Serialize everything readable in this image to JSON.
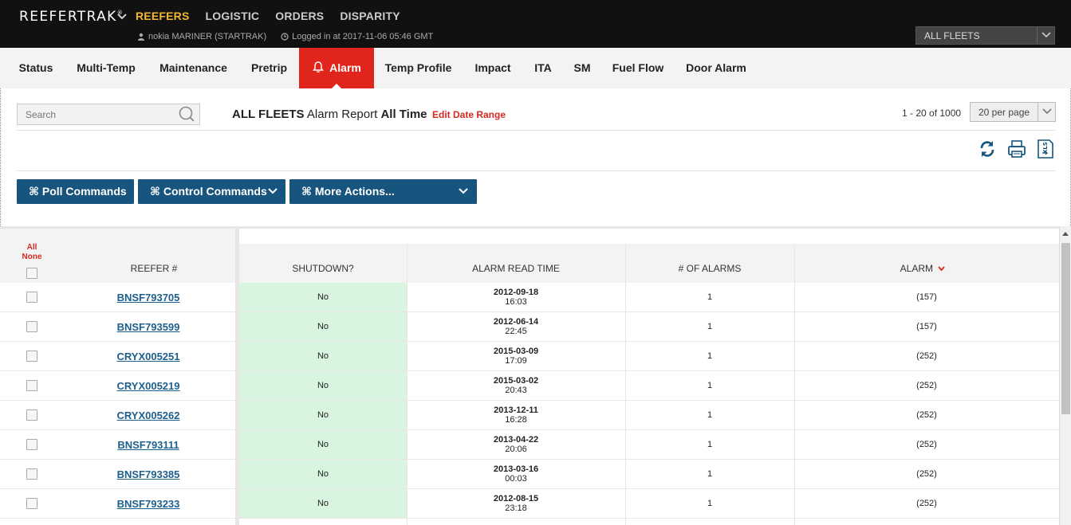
{
  "brand": {
    "name": "REEFERTRAK",
    "mark": "®"
  },
  "topnav": [
    {
      "label": "REEFERS",
      "active": true
    },
    {
      "label": "LOGISTIC",
      "active": false
    },
    {
      "label": "ORDERS",
      "active": false
    },
    {
      "label": "DISPARITY",
      "active": false
    }
  ],
  "user": {
    "name": "nokia MARINER (STARTRAK)",
    "login": "Logged in at 2017-11-06 05:46 GMT"
  },
  "fleet_select": {
    "value": "ALL FLEETS"
  },
  "tabs": [
    {
      "label": "Status"
    },
    {
      "label": "Multi-Temp"
    },
    {
      "label": "Maintenance"
    },
    {
      "label": "Pretrip"
    },
    {
      "label": "Alarm",
      "active": true
    },
    {
      "label": "Temp Profile"
    },
    {
      "label": "Impact"
    },
    {
      "label": "ITA"
    },
    {
      "label": "SM"
    },
    {
      "label": "Fuel Flow"
    },
    {
      "label": "Door Alarm"
    }
  ],
  "search": {
    "placeholder": "Search"
  },
  "report": {
    "fleet": "ALL FLEETS",
    "name": "Alarm Report",
    "range": "All Time",
    "edit_label": "Edit Date Range"
  },
  "pagination": {
    "text": "1 - 20 of 1000",
    "per_page": "20 per page"
  },
  "actions": {
    "poll": "⌘ Poll Commands",
    "control": "⌘ Control Commands",
    "more": "⌘ More Actions..."
  },
  "table": {
    "select_all": "All",
    "select_none": "None",
    "headers": {
      "reefer": "REEFER #",
      "shutdown": "SHUTDOWN?",
      "read_time": "ALARM READ TIME",
      "count": "# OF ALARMS",
      "alarm": "ALARM"
    },
    "rows": [
      {
        "reefer": "BNSF793705",
        "shutdown": "No",
        "date": "2012-09-18",
        "time": "16:03",
        "count": "1",
        "alarm": "(157)"
      },
      {
        "reefer": "BNSF793599",
        "shutdown": "No",
        "date": "2012-06-14",
        "time": "22:45",
        "count": "1",
        "alarm": "(157)"
      },
      {
        "reefer": "CRYX005251",
        "shutdown": "No",
        "date": "2015-03-09",
        "time": "17:09",
        "count": "1",
        "alarm": "(252)"
      },
      {
        "reefer": "CRYX005219",
        "shutdown": "No",
        "date": "2015-03-02",
        "time": "20:43",
        "count": "1",
        "alarm": "(252)"
      },
      {
        "reefer": "CRYX005262",
        "shutdown": "No",
        "date": "2013-12-11",
        "time": "16:28",
        "count": "1",
        "alarm": "(252)"
      },
      {
        "reefer": "BNSF793111",
        "shutdown": "No",
        "date": "2013-04-22",
        "time": "20:06",
        "count": "1",
        "alarm": "(252)"
      },
      {
        "reefer": "BNSF793385",
        "shutdown": "No",
        "date": "2013-03-16",
        "time": "00:03",
        "count": "1",
        "alarm": "(252)"
      },
      {
        "reefer": "BNSF793233",
        "shutdown": "No",
        "date": "2012-08-15",
        "time": "23:18",
        "count": "1",
        "alarm": "(252)"
      }
    ]
  },
  "colors": {
    "accent_red": "#e0261c",
    "nav_gold": "#f5b731",
    "button_blue": "#17557f",
    "shutdown_green": "#d9f5e0",
    "link_blue": "#1d5f8c"
  }
}
